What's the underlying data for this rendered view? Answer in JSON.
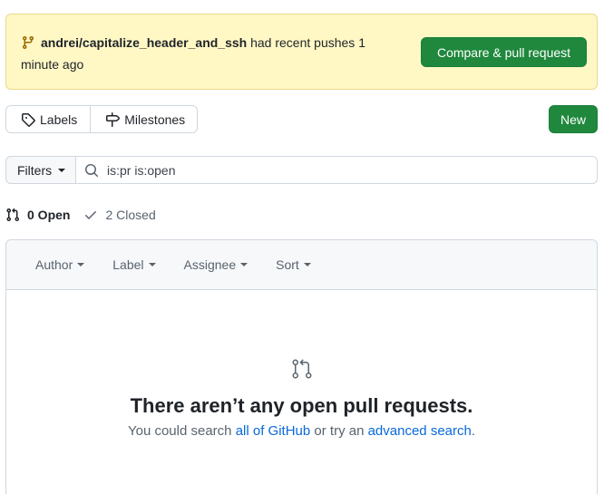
{
  "banner": {
    "branch": "andrei/capitalize_header_and_ssh",
    "message": " had recent pushes 1 minute ago",
    "button": "Compare & pull request"
  },
  "nav": {
    "labels": "Labels",
    "milestones": "Milestones",
    "new_button": "New"
  },
  "filters": {
    "button": "Filters",
    "search_value": "is:pr is:open"
  },
  "states": {
    "open": "0 Open",
    "closed": "2 Closed"
  },
  "list_header": {
    "author": "Author",
    "label": "Label",
    "assignee": "Assignee",
    "sort": "Sort"
  },
  "blankslate": {
    "title": "There aren’t any open pull requests.",
    "desc_prefix": "You could search ",
    "link_all": "all of GitHub",
    "desc_middle": " or try an ",
    "link_advanced": "advanced search",
    "desc_suffix": "."
  },
  "colors": {
    "primary_button": "#1f883d",
    "banner_bg": "#fff8c5",
    "link": "#0969da",
    "branch_icon": "#9a6700"
  },
  "icons": [
    "git-branch-icon",
    "tag-icon",
    "milestone-icon",
    "search-icon",
    "git-pull-request-icon",
    "check-icon"
  ]
}
